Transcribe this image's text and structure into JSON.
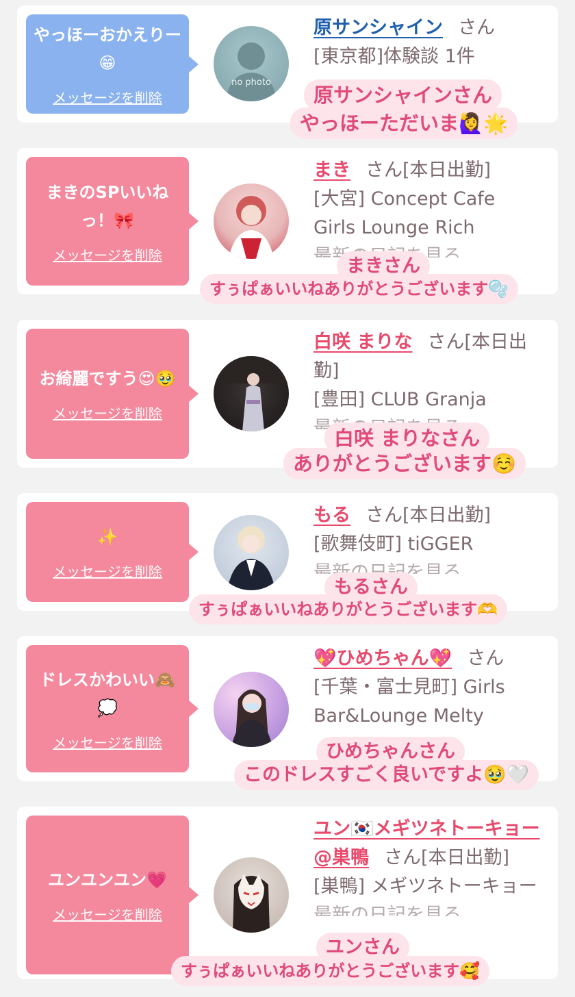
{
  "delete_label": "メッセージを削除",
  "san_suffix": "さん",
  "messages": [
    {
      "bubble_text": "やっほーおかえりー😁",
      "bubble_color": "#8ab2ee",
      "name": "原サンシャイン",
      "name_color": "#1f5fae",
      "name_suffix": "さん",
      "shop_lines": [
        "[東京都]体験談 1件"
      ],
      "faded_line": "",
      "avatar_label": "no photo",
      "caption_name": "原サンシャインさん",
      "caption_text": "やっほーただいま🙋‍♀️🌟"
    },
    {
      "bubble_text": "まきのSPいいねっ！🎀",
      "bubble_color": "#f4899e",
      "name": "まき",
      "name_color": "#e84a6c",
      "name_suffix": "さん[本日出勤]",
      "shop_lines": [
        "[大宮] Concept Cafe",
        "Girls Lounge Rich"
      ],
      "faded_line": "最新の日記を見る",
      "avatar_label": "",
      "caption_name": "まきさん",
      "caption_text": "すぅぱぁいいねありがとうございます🫧"
    },
    {
      "bubble_text": "お綺麗ですう😍🥹",
      "bubble_color": "#f4899e",
      "name": "白咲 まりな",
      "name_color": "#e84a6c",
      "name_suffix": "さん[本日出勤]",
      "shop_lines": [
        "[豊田] CLUB Granja"
      ],
      "faded_line": "最新の日記を見る",
      "avatar_label": "",
      "caption_name": "白咲 まりなさん",
      "caption_text": "ありがとうございます☺️"
    },
    {
      "bubble_text": "✨",
      "bubble_color": "#f4899e",
      "name": "もる",
      "name_color": "#e84a6c",
      "name_suffix": "さん[本日出勤]",
      "shop_lines": [
        "[歌舞伎町] tiGGER"
      ],
      "faded_line": "最新の日記を見る",
      "avatar_label": "",
      "caption_name": "もるさん",
      "caption_text": "すぅぱぁいいねありがとうございます🫶"
    },
    {
      "bubble_text": "ドレスかわいい🙈💭",
      "bubble_color": "#f4899e",
      "name": "💖ひめちゃん💖",
      "name_color": "#e84a6c",
      "name_suffix": "さん",
      "shop_lines": [
        "[千葉・富士見町] Girls",
        "Bar&Lounge Melty"
      ],
      "faded_line": "",
      "avatar_label": "",
      "caption_name": "ひめちゃんさん",
      "caption_text": "このドレスすごく良いですよ🥹🤍"
    },
    {
      "bubble_text": "ユンユンユン💗",
      "bubble_color": "#f4899e",
      "name": "ユン🇰🇷メギツネトーキョー@巣鴨",
      "name_color": "#e84a6c",
      "name_suffix": "さん[本日出勤]",
      "shop_lines": [
        "[巣鴨] メギツネトーキョー"
      ],
      "faded_line": "最新の日記を見る",
      "avatar_label": "",
      "caption_name": "ユンさん",
      "caption_text": "すぅぱぁいいねありがとうございます🥰"
    }
  ]
}
